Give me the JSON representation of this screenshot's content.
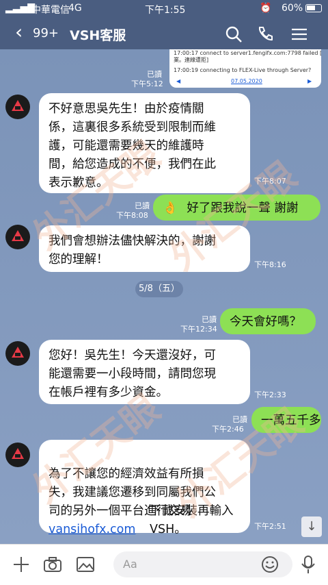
{
  "status_bar": {
    "carrier": "中華電信",
    "network": "4G",
    "time": "下午1:55",
    "battery": "60%"
  },
  "header": {
    "unread_count": "99+",
    "title": "VSH客服"
  },
  "screenshot_preview": {
    "line1": "17:00:17 connect to server1.fengifx.com:7798 failed [無法完成IP",
    "line2": "業。連線遭拒]",
    "line3": "17:00:19 connecting to FLEX-Live through Server?",
    "date": "07.05.2020"
  },
  "messages": [
    {
      "side": "mine",
      "read": "已讀",
      "time": "下午5:12",
      "text": ""
    },
    {
      "side": "theirs",
      "time": "下午8:07",
      "text": "不好意思吳先生！由於疫情關\n係，這裏很多系統受到限制而維\n護，可能還需要幾天的維護時\n間，給您造成的不便，我們在此\n表示歉意。"
    },
    {
      "side": "mine",
      "read": "已讀",
      "time": "下午8:08",
      "emoji": "👌",
      "text": "好了跟我說一聲 謝謝"
    },
    {
      "side": "theirs",
      "time": "下午8:16",
      "text": "我們會想辦法儘快解決的，謝謝\n您的理解！"
    },
    {
      "side": "mine",
      "read": "已讀",
      "time": "下午12:34",
      "text": "今天會好嗎？"
    },
    {
      "side": "theirs",
      "time": "下午2:33",
      "text": "您好！吳先生！今天還沒好，可\n能還需要一小段時間，請問您現\n在帳戶裡有多少資金。"
    },
    {
      "side": "mine",
      "read": "已讀",
      "time": "下午2:46",
      "text": "一萬五千多"
    },
    {
      "side": "theirs",
      "time": "下午2:51",
      "text_a": "為了不讓您的經濟效益有所損\n失，我建議您遷移到同屬我們公\n司的另外一個平台進行交易",
      "link": "vansihofx.com",
      "text_b": "下載安裝再輸入\nVSH。"
    }
  ],
  "date_separator": "5/8（五）",
  "input": {
    "placeholder": "Aa"
  },
  "watermark": {
    "text": "外汇天眼",
    "app": "APP"
  }
}
